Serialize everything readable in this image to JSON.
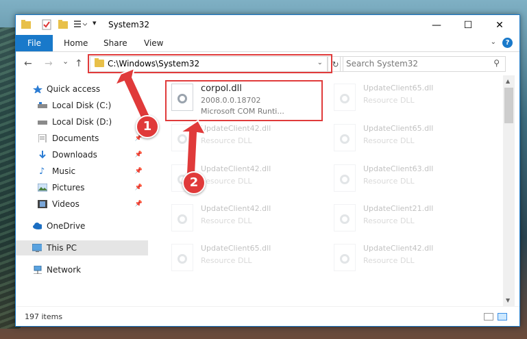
{
  "window": {
    "title": "System32",
    "controls": {
      "minimize": "—",
      "maximize": "☐",
      "close": "✕"
    }
  },
  "ribbon": {
    "tabs": [
      "File",
      "Home",
      "Share",
      "View"
    ]
  },
  "nav": {
    "back_icon": "←",
    "forward_icon": "→",
    "recent_icon": "⌄",
    "up_icon": "↑"
  },
  "address": {
    "path": "C:\\Windows\\System32"
  },
  "search": {
    "placeholder": "Search System32"
  },
  "sidebar": {
    "items": [
      {
        "label": "Quick access",
        "icon": "star-icon"
      },
      {
        "label": "Local Disk (C:)",
        "icon": "drive-icon"
      },
      {
        "label": "Local Disk (D:)",
        "icon": "drive-icon"
      },
      {
        "label": "Documents",
        "icon": "documents-icon"
      },
      {
        "label": "Downloads",
        "icon": "download-icon"
      },
      {
        "label": "Music",
        "icon": "music-icon"
      },
      {
        "label": "Pictures",
        "icon": "pictures-icon"
      },
      {
        "label": "Videos",
        "icon": "videos-icon"
      },
      {
        "label": "OneDrive",
        "icon": "cloud-icon"
      },
      {
        "label": "This PC",
        "icon": "computer-icon"
      },
      {
        "label": "Network",
        "icon": "network-icon"
      }
    ]
  },
  "files": [
    {
      "name": "corpol.dll",
      "line2": "2008.0.0.18702",
      "line3": "Microsoft COM Runti..."
    },
    {
      "name": "UpdateClient65.dll",
      "line2": "Resource DLL"
    },
    {
      "name": "UpdateClient42.dll",
      "line2": "Resource DLL"
    },
    {
      "name": "UpdateClient65.dll",
      "line2": "Resource DLL"
    },
    {
      "name": "UpdateClient42.dll",
      "line2": "Resource DLL"
    },
    {
      "name": "UpdateClient63.dll",
      "line2": "Resource DLL"
    },
    {
      "name": "UpdateClient42.dll",
      "line2": "Resource DLL"
    },
    {
      "name": "UpdateClient21.dll",
      "line2": "Resource DLL"
    },
    {
      "name": "UpdateClient65.dll",
      "line2": "Resource DLL"
    },
    {
      "name": "UpdateClient42.dll",
      "line2": "Resource DLL"
    }
  ],
  "status": {
    "count": "197 items"
  },
  "annotations": [
    "1",
    "2"
  ],
  "colors": {
    "accent": "#1979ca",
    "highlight": "#e03a3a"
  }
}
